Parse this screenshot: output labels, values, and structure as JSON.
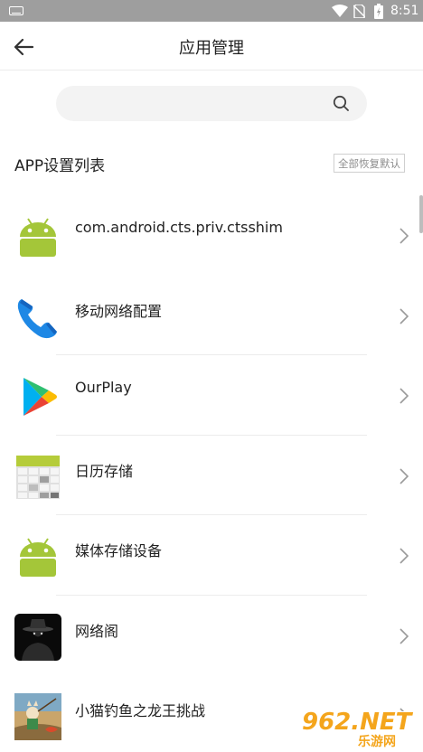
{
  "status_bar": {
    "time": "8:51",
    "icons": [
      "keyboard-icon",
      "wifi-icon",
      "no-sim-icon",
      "battery-icon"
    ]
  },
  "header": {
    "title": "应用管理",
    "back_icon": "arrow-left-icon"
  },
  "search": {
    "placeholder": "",
    "value": "",
    "icon": "search-icon"
  },
  "section": {
    "title": "APP设置列表",
    "reset_all_label": "全部恢复默认"
  },
  "apps": [
    {
      "name": "com.android.cts.priv.ctsshim",
      "icon": "android-robot-icon"
    },
    {
      "name": "移动网络配置",
      "icon": "phone-handset-icon"
    },
    {
      "name": "OurPlay",
      "icon": "play-triangle-icon"
    },
    {
      "name": "日历存储",
      "icon": "calendar-grid-icon"
    },
    {
      "name": "媒体存储设备",
      "icon": "android-robot-icon"
    },
    {
      "name": "网络阁",
      "icon": "hat-figure-icon"
    },
    {
      "name": "小猫钓鱼之龙王挑战",
      "icon": "cat-fishing-game-icon"
    }
  ],
  "watermark": {
    "main": "962.NET",
    "sub": "乐游网"
  },
  "colors": {
    "status_bar_bg": "#9e9e9e",
    "android_green": "#a4c639",
    "phone_blue": "#1e88e5",
    "watermark_orange": "#f4a51c"
  }
}
